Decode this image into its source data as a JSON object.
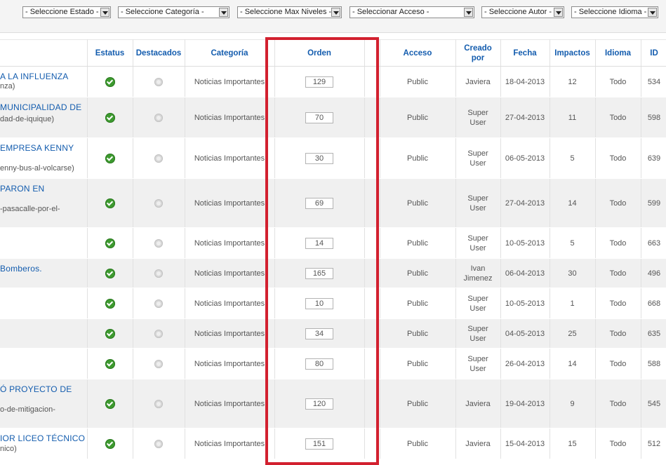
{
  "filters": [
    {
      "name": "estado",
      "label": "- Seleccione Estado -"
    },
    {
      "name": "categoria",
      "label": "- Seleccione Categoría -"
    },
    {
      "name": "max-niveles",
      "label": "- Seleccione Max Niveles -"
    },
    {
      "name": "acceso",
      "label": "- Seleccionar Acceso -"
    },
    {
      "name": "autor",
      "label": "- Seleccione Autor -"
    },
    {
      "name": "idioma",
      "label": "- Seleccione Idioma -"
    }
  ],
  "columns": {
    "estatus": "Estatus",
    "destacados": "Destacados",
    "categoria": "Categoría",
    "orden": "Orden",
    "acceso": "Acceso",
    "creado_por_1": "Creado",
    "creado_por_2": "por",
    "fecha": "Fecha",
    "impactos": "Impactos",
    "idioma": "Idioma",
    "id": "ID"
  },
  "rows": [
    {
      "title": "A LA INFLUENZA",
      "alias": "nza)",
      "category": "Noticias Importantes",
      "order": "129",
      "access": "Public",
      "author1": "Javiera",
      "author2": "",
      "date": "18-04-2013",
      "hits": "12",
      "lang": "Todo",
      "id": "534"
    },
    {
      "title": "MUNICIPALIDAD DE",
      "alias": "dad-de-iquique)",
      "category": "Noticias Importantes",
      "order": "70",
      "access": "Public",
      "author1": "Super",
      "author2": "User",
      "date": "27-04-2013",
      "hits": "11",
      "lang": "Todo",
      "id": "598"
    },
    {
      "title": "EMPRESA KENNY",
      "alias": "enny-bus-al-volcarse)",
      "category": "Noticias Importantes",
      "order": "30",
      "access": "Public",
      "author1": "Super",
      "author2": "User",
      "date": "06-05-2013",
      "hits": "5",
      "lang": "Todo",
      "id": "639"
    },
    {
      "title": "PARON EN",
      "alias": "-pasacalle-por-el-",
      "category": "Noticias Importantes",
      "order": "69",
      "access": "Public",
      "author1": "Super",
      "author2": "User",
      "date": "27-04-2013",
      "hits": "14",
      "lang": "Todo",
      "id": "599"
    },
    {
      "title": "",
      "alias": "",
      "category": "Noticias Importantes",
      "order": "14",
      "access": "Public",
      "author1": "Super",
      "author2": "User",
      "date": "10-05-2013",
      "hits": "5",
      "lang": "Todo",
      "id": "663"
    },
    {
      "title": " Bomberos.",
      "alias": "",
      "category": "Noticias Importantes",
      "order": "165",
      "access": "Public",
      "author1": "Ivan",
      "author2": "Jimenez",
      "date": "06-04-2013",
      "hits": "30",
      "lang": "Todo",
      "id": "496"
    },
    {
      "title": "",
      "alias": "",
      "category": "Noticias Importantes",
      "order": "10",
      "access": "Public",
      "author1": "Super",
      "author2": "User",
      "date": "10-05-2013",
      "hits": "1",
      "lang": "Todo",
      "id": "668"
    },
    {
      "title": "",
      "alias": "",
      "category": "Noticias Importantes",
      "order": "34",
      "access": "Public",
      "author1": "Super",
      "author2": "User",
      "date": "04-05-2013",
      "hits": "25",
      "lang": "Todo",
      "id": "635"
    },
    {
      "title": "",
      "alias": "",
      "category": "Noticias Importantes",
      "order": "80",
      "access": "Public",
      "author1": "Super",
      "author2": "User",
      "date": "26-04-2013",
      "hits": "14",
      "lang": "Todo",
      "id": "588"
    },
    {
      "title": "Ó PROYECTO DE",
      "alias": "o-de-mitigacion-",
      "category": "Noticias Importantes",
      "order": "120",
      "access": "Public",
      "author1": "Javiera",
      "author2": "",
      "date": "19-04-2013",
      "hits": "9",
      "lang": "Todo",
      "id": "545"
    },
    {
      "title": "IOR LICEO TÉCNICO",
      "alias": "nico)",
      "category": "Noticias Importantes",
      "order": "151",
      "access": "Public",
      "author1": "Javiera",
      "author2": "",
      "date": "15-04-2013",
      "hits": "15",
      "lang": "Todo",
      "id": "512"
    }
  ],
  "colors": {
    "accent": "#135cae",
    "highlight": "#d2202f",
    "published": "#3d9a2f"
  }
}
